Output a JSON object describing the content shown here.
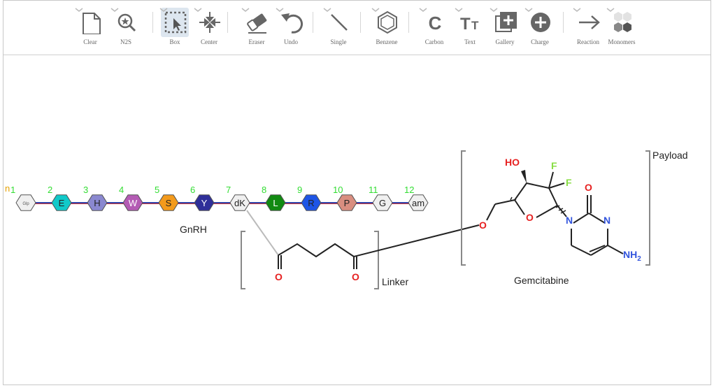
{
  "toolbar": {
    "items": [
      {
        "label": "Clear",
        "icon": "blank-page-icon"
      },
      {
        "label": "N2S",
        "icon": "search-star-icon"
      },
      {
        "label": "Box",
        "icon": "box-select-icon",
        "active": true
      },
      {
        "label": "Center",
        "icon": "center-arrows-icon"
      },
      {
        "label": "Eraser",
        "icon": "eraser-icon"
      },
      {
        "label": "Undo",
        "icon": "undo-icon"
      },
      {
        "label": "Single",
        "icon": "single-bond-icon"
      },
      {
        "label": "Benzene",
        "icon": "benzene-icon"
      },
      {
        "label": "Carbon",
        "icon": "carbon-icon"
      },
      {
        "label": "Text",
        "icon": "text-icon"
      },
      {
        "label": "Gallery",
        "icon": "gallery-icon"
      },
      {
        "label": "Charge",
        "icon": "charge-icon"
      },
      {
        "label": "Reaction",
        "icon": "reaction-arrow-icon"
      },
      {
        "label": "Monomers",
        "icon": "monomers-icon"
      }
    ],
    "carbon_glyph": "C",
    "text_glyph": "TT"
  },
  "canvas": {
    "peptide": {
      "n_terminal": "n",
      "residues": [
        {
          "number": "1",
          "code": "Glp",
          "color": "#f0f0f0",
          "text_color": "#555555"
        },
        {
          "number": "2",
          "code": "E",
          "color": "#11c9c9",
          "text_color": "#222222"
        },
        {
          "number": "3",
          "code": "H",
          "color": "#8a88d0",
          "text_color": "#222222"
        },
        {
          "number": "4",
          "code": "W",
          "color": "#b45bb4",
          "text_color": "#ffffff"
        },
        {
          "number": "5",
          "code": "S",
          "color": "#f39a1c",
          "text_color": "#222222"
        },
        {
          "number": "6",
          "code": "Y",
          "color": "#2f2f99",
          "text_color": "#ffffff"
        },
        {
          "number": "7",
          "code": "dK",
          "color": "#f0f0f0",
          "text_color": "#222222"
        },
        {
          "number": "8",
          "code": "L",
          "color": "#118a11",
          "text_color": "#ffffff"
        },
        {
          "number": "9",
          "code": "R",
          "color": "#1e55e6",
          "text_color": "#222222"
        },
        {
          "number": "10",
          "code": "P",
          "color": "#d98e80",
          "text_color": "#222222"
        },
        {
          "number": "11",
          "code": "G",
          "color": "#f0f0f0",
          "text_color": "#222222"
        },
        {
          "number": "12",
          "code": "am",
          "color": "#f0f0f0",
          "text_color": "#222222"
        }
      ],
      "label": "GnRH"
    },
    "linker": {
      "label": "Linker",
      "o1": "O",
      "o2": "O"
    },
    "payload": {
      "label": "Payload",
      "drug_name": "Gemcitabine",
      "atoms": {
        "ho": "HO",
        "f1": "F",
        "f2": "F",
        "o_ether": "O",
        "o_ring": "O",
        "n1": "N",
        "n3": "N",
        "o_carbonyl": "O",
        "nh2": "NH",
        "nh2_sub": "2"
      }
    },
    "colors": {
      "number_green": "#33dd33",
      "n_orange": "#e6a100",
      "oxygen": "#e62020",
      "fluorine": "#88dd44",
      "nitrogen": "#3355dd"
    }
  }
}
